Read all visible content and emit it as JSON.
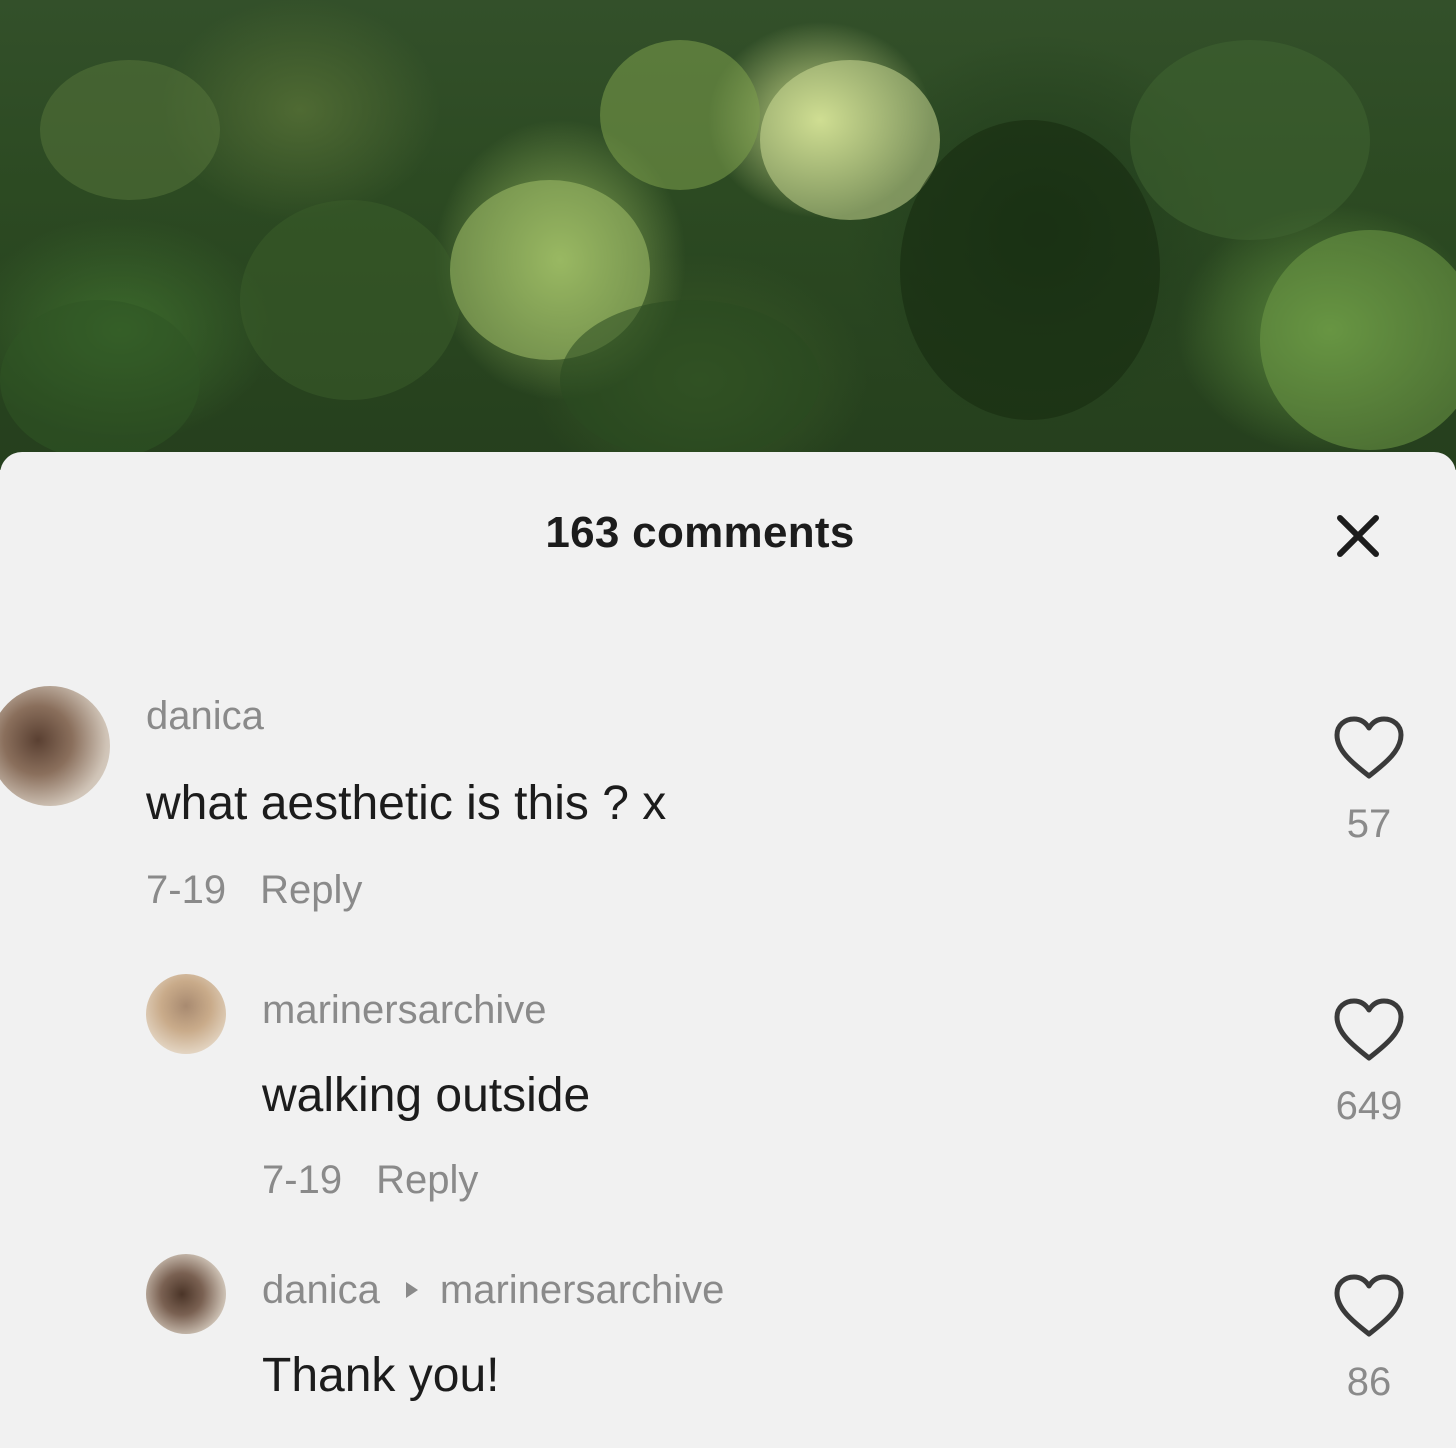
{
  "panel": {
    "title": "163 comments"
  },
  "icons": {
    "close": "close-icon",
    "like": "heart-outline-icon"
  },
  "comments": [
    {
      "username": "danica",
      "text": "what aesthetic is this ? x",
      "date": "7-19",
      "reply_label": "Reply",
      "likes": "57"
    },
    {
      "username": "marinersarchive",
      "text": "walking outside",
      "date": "7-19",
      "reply_label": "Reply",
      "likes": "649"
    },
    {
      "username": "danica",
      "reply_to": "marinersarchive",
      "text": "Thank you!",
      "likes": "86"
    }
  ],
  "colors": {
    "sheet_background": "#f1f1f1",
    "primary_text": "#1c1c1c",
    "secondary_text": "#8a8a8a"
  }
}
